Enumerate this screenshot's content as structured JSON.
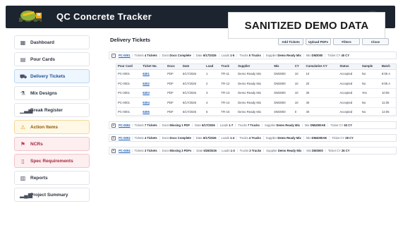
{
  "app": {
    "title": "QC Concrete Tracker"
  },
  "overlay": {
    "text": "SANITIZED DEMO DATA"
  },
  "sidebar": {
    "items": [
      {
        "label": "Dashboard",
        "icon": "dashboard-icon",
        "state": "normal"
      },
      {
        "label": "Pour Cards",
        "icon": "clipboard-icon",
        "state": "normal"
      },
      {
        "label": "Delivery Tickets",
        "icon": "truck-icon",
        "state": "active"
      },
      {
        "label": "Mix Designs",
        "icon": "flask-icon",
        "state": "normal"
      },
      {
        "label": "Break Register",
        "icon": "bar-chart-icon",
        "state": "normal"
      },
      {
        "label": "Action Items",
        "icon": "warning-icon",
        "state": "warn"
      },
      {
        "label": "NCRs",
        "icon": "flag-icon",
        "state": "alert"
      },
      {
        "label": "Spec Requirements",
        "icon": "spec-doc-icon",
        "state": "alert"
      },
      {
        "label": "Reports",
        "icon": "report-icon",
        "state": "normal"
      },
      {
        "label": "Project Summary",
        "icon": "summary-chart-icon",
        "state": "normal"
      }
    ]
  },
  "main": {
    "title": "Delivery Tickets",
    "toolbar": {
      "add_label": "Add Tickets",
      "upload_label": "Upload PDFs",
      "filters_label": "Filters",
      "close_label": "Close"
    },
    "groups": [
      {
        "toggle": "-",
        "card": "PC-0001",
        "tickets_label": "Tickets",
        "tickets_value": "4 Tickets",
        "docs_label": "Docs",
        "docs_value": "Docs Complete",
        "date_label": "Date",
        "date_value": "6/17/2026",
        "loads_label": "Loads",
        "loads_value": "1-5",
        "trucks_label": "Trucks",
        "trucks_value": "5 Trucks",
        "supplier_label": "Supplier",
        "supplier_value": "Demo Ready Mix",
        "mix_label": "Mix",
        "mix_value": "DM3000",
        "cy_label": "Ticket CY",
        "cy_value": "40 CY"
      },
      {
        "toggle": "+",
        "card": "PC-0002",
        "tickets_label": "Tickets",
        "tickets_value": "7 Tickets",
        "docs_label": "Docs",
        "docs_value": "Missing 1 PDF",
        "date_label": "Date",
        "date_value": "6/17/2026",
        "loads_label": "Loads",
        "loads_value": "1-7",
        "trucks_label": "Trucks",
        "trucks_value": "7 Trucks",
        "supplier_label": "Supplier",
        "supplier_value": "Demo Ready Mix",
        "mix_label": "Mix",
        "mix_value": "DM4000AE",
        "cy_label": "Ticket CY",
        "cy_value": "63 CY"
      },
      {
        "toggle": "+",
        "card": "PC-0003",
        "tickets_label": "Tickets",
        "tickets_value": "4 Tickets",
        "docs_label": "Docs",
        "docs_value": "Docs Complete",
        "date_label": "Date",
        "date_value": "6/17/2026",
        "loads_label": "Loads",
        "loads_value": "1-4",
        "trucks_label": "Trucks",
        "trucks_value": "4 Trucks",
        "supplier_label": "Supplier",
        "supplier_value": "Demo Ready Mix",
        "mix_label": "Mix",
        "mix_value": "DM4000AE",
        "cy_label": "Ticket CY",
        "cy_value": "28 CY"
      },
      {
        "toggle": "+",
        "card": "PC-0004",
        "tickets_label": "Tickets",
        "tickets_value": "3 Tickets",
        "docs_label": "Docs",
        "docs_value": "Missing 3 PDFs",
        "date_label": "Date",
        "date_value": "6/28/2026",
        "loads_label": "Loads",
        "loads_value": "1-3",
        "trucks_label": "Trucks",
        "trucks_value": "3 Trucks",
        "supplier_label": "Supplier",
        "supplier_value": "Demo Ready Mix",
        "mix_label": "Mix",
        "mix_value": "DM3000",
        "cy_label": "Ticket CY",
        "cy_value": "26 CY"
      }
    ],
    "table": {
      "columns": [
        "Pour Card",
        "Ticket No.",
        "Docs",
        "Date",
        "Load",
        "Truck",
        "Supplier",
        "Mix",
        "CY",
        "Cumulative CY",
        "Status",
        "Sample",
        "Batch"
      ],
      "rows": [
        [
          "PC-0001",
          "6301",
          "PDF",
          "6/17/2026",
          "1",
          "TR-11",
          "Demo Ready Mix",
          "DM3000",
          "10",
          "10",
          "Accepted",
          "No",
          "8:05 A"
        ],
        [
          "PC-0001",
          "6302",
          "PDF",
          "6/17/2026",
          "2",
          "TR-12",
          "Demo Ready Mix",
          "DM3000",
          "10",
          "20",
          "Accepted",
          "No",
          "9:05 A"
        ],
        [
          "PC-0001",
          "6303",
          "PDF",
          "6/17/2026",
          "3",
          "TR-13",
          "Demo Ready Mix",
          "DM3000",
          "10",
          "30",
          "Accepted",
          "Yes",
          "10:05"
        ],
        [
          "PC-0001",
          "6304",
          "PDF",
          "6/17/2026",
          "4",
          "TR-14",
          "Demo Ready Mix",
          "DM3000",
          "10",
          "40",
          "Accepted",
          "No",
          "11:05"
        ],
        [
          "PC-0001",
          "6305",
          "PDF",
          "6/17/2026",
          "5",
          "TR-15",
          "Demo Ready Mix",
          "DM3000",
          "0",
          "40",
          "Accepted",
          "No",
          "12:05"
        ]
      ]
    }
  }
}
